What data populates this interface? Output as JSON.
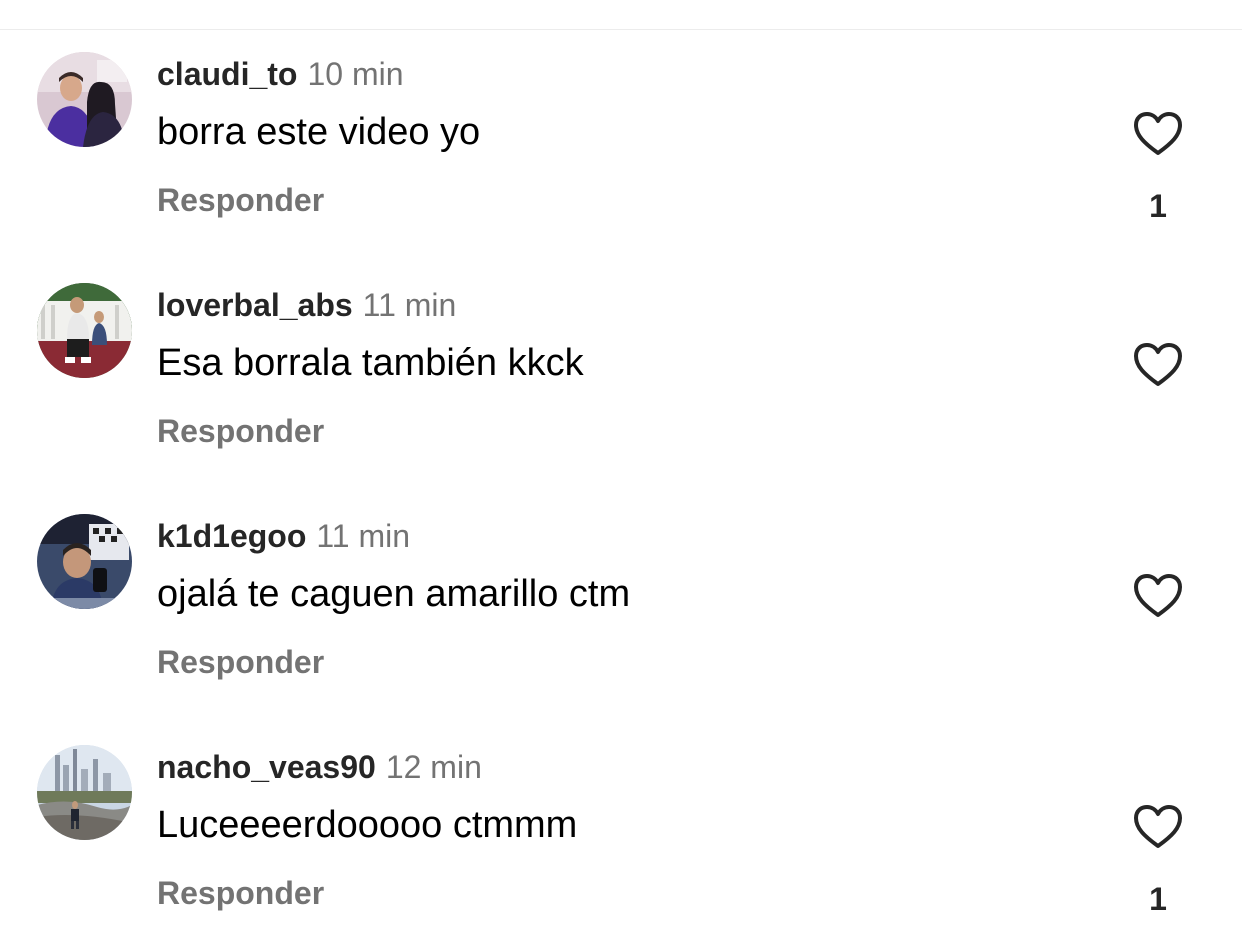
{
  "comments": [
    {
      "username": "claudi_to",
      "time": "10 min",
      "text": "borra este video yo",
      "reply_label": "Responder",
      "like_count": "1",
      "avatar_icon": "avatar-couple-photo",
      "like_icon": "heart-outline-icon"
    },
    {
      "username": "loverbal_abs",
      "time": "11 min",
      "text": "Esa borrala también kkck",
      "reply_label": "Responder",
      "like_count": "",
      "avatar_icon": "avatar-people-porch-photo",
      "like_icon": "heart-outline-icon"
    },
    {
      "username": "k1d1egoo",
      "time": "11 min",
      "text": "ojalá te caguen amarillo ctm",
      "reply_label": "Responder",
      "like_count": "",
      "avatar_icon": "avatar-selfie-photo",
      "like_icon": "heart-outline-icon"
    },
    {
      "username": "nacho_veas90",
      "time": "12 min",
      "text": "Luceeeerdooooo ctmmm",
      "reply_label": "Responder",
      "like_count": "1",
      "avatar_icon": "avatar-city-skyline-photo",
      "like_icon": "heart-outline-icon"
    }
  ],
  "colors": {
    "username": "#262626",
    "secondary_text": "#737373",
    "icon_stroke": "#262626"
  }
}
